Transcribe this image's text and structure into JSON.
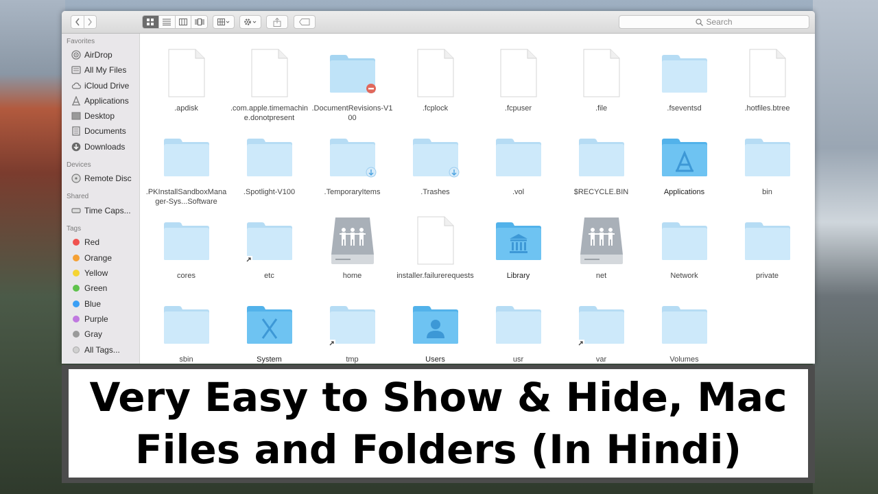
{
  "toolbar": {
    "search_placeholder": "Search"
  },
  "sidebar": {
    "favorites_heading": "Favorites",
    "favorites": [
      {
        "label": "AirDrop",
        "icon": "airdrop-icon"
      },
      {
        "label": "All My Files",
        "icon": "all-files-icon"
      },
      {
        "label": "iCloud Drive",
        "icon": "cloud-icon"
      },
      {
        "label": "Applications",
        "icon": "applications-icon"
      },
      {
        "label": "Desktop",
        "icon": "desktop-icon"
      },
      {
        "label": "Documents",
        "icon": "documents-icon"
      },
      {
        "label": "Downloads",
        "icon": "downloads-icon"
      }
    ],
    "devices_heading": "Devices",
    "devices": [
      {
        "label": "Remote Disc",
        "icon": "disc-icon"
      }
    ],
    "shared_heading": "Shared",
    "shared": [
      {
        "label": "Time Caps...",
        "icon": "time-capsule-icon"
      }
    ],
    "tags_heading": "Tags",
    "tags": [
      {
        "label": "Red",
        "color": "#f0524f"
      },
      {
        "label": "Orange",
        "color": "#f5a033"
      },
      {
        "label": "Yellow",
        "color": "#f5d433"
      },
      {
        "label": "Green",
        "color": "#5fc24c"
      },
      {
        "label": "Blue",
        "color": "#3a9ff5"
      },
      {
        "label": "Purple",
        "color": "#c078e0"
      },
      {
        "label": "Gray",
        "color": "#9a9a9a"
      },
      {
        "label": "All Tags...",
        "color": "#d0d0d0"
      }
    ]
  },
  "files": [
    {
      "name": ".apdisk",
      "kind": "document"
    },
    {
      "name": ".com.apple.timemachine.donotpresent",
      "kind": "document"
    },
    {
      "name": ".DocumentRevisions-V100",
      "kind": "folder-restricted"
    },
    {
      "name": ".fcplock",
      "kind": "document"
    },
    {
      "name": ".fcpuser",
      "kind": "document"
    },
    {
      "name": ".file",
      "kind": "document"
    },
    {
      "name": ".fseventsd",
      "kind": "folder"
    },
    {
      "name": ".hotfiles.btree",
      "kind": "document"
    },
    {
      "name": ".PKInstallSandboxManager-Sys...Software",
      "kind": "folder"
    },
    {
      "name": ".Spotlight-V100",
      "kind": "folder"
    },
    {
      "name": ".TemporaryItems",
      "kind": "folder-download"
    },
    {
      "name": ".Trashes",
      "kind": "folder-download"
    },
    {
      "name": ".vol",
      "kind": "folder"
    },
    {
      "name": "$RECYCLE.BIN",
      "kind": "folder"
    },
    {
      "name": "Applications",
      "kind": "folder-applications"
    },
    {
      "name": "bin",
      "kind": "folder"
    },
    {
      "name": "cores",
      "kind": "folder"
    },
    {
      "name": "etc",
      "kind": "folder-alias"
    },
    {
      "name": "home",
      "kind": "network-drive"
    },
    {
      "name": "installer.failurerequests",
      "kind": "document"
    },
    {
      "name": "Library",
      "kind": "folder-library"
    },
    {
      "name": "net",
      "kind": "network-drive"
    },
    {
      "name": "Network",
      "kind": "folder"
    },
    {
      "name": "private",
      "kind": "folder"
    },
    {
      "name": "sbin",
      "kind": "folder"
    },
    {
      "name": "System",
      "kind": "folder-system"
    },
    {
      "name": "tmp",
      "kind": "folder-alias"
    },
    {
      "name": "Users",
      "kind": "folder-users"
    },
    {
      "name": "usr",
      "kind": "folder"
    },
    {
      "name": "var",
      "kind": "folder-alias"
    },
    {
      "name": "Volumes",
      "kind": "folder"
    }
  ],
  "banner": {
    "line1": "Very Easy to Show & Hide, Mac",
    "line2": "Files and Folders (In Hindi)"
  }
}
